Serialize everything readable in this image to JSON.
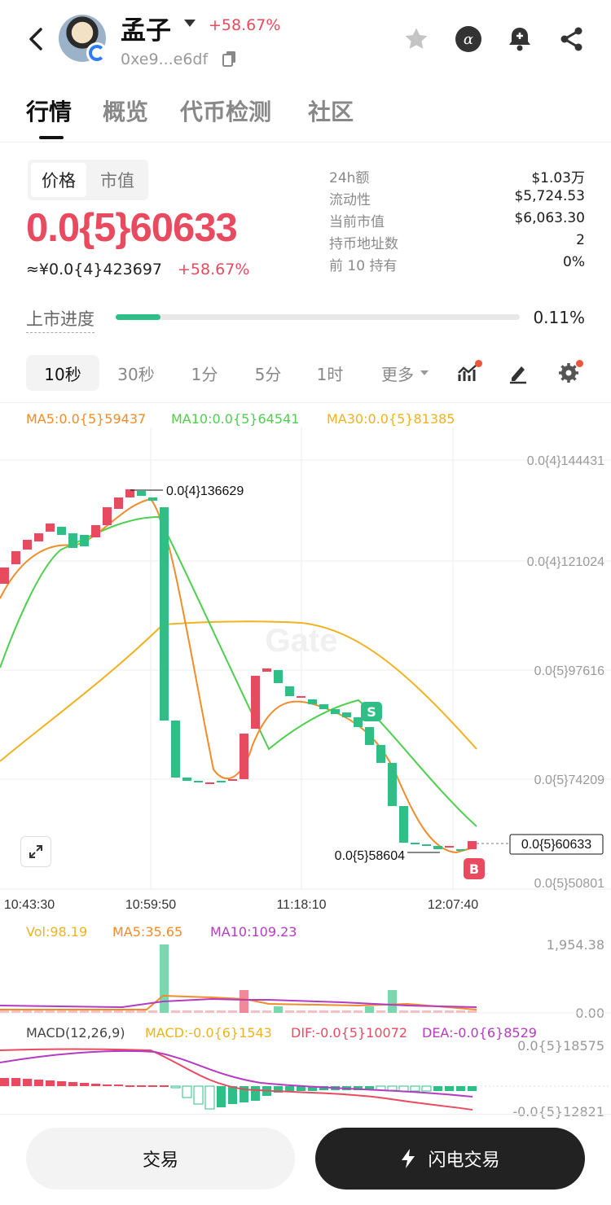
{
  "header": {
    "token_name": "孟子",
    "change": "+58.67%",
    "address": "0xe9...e6df",
    "icons": [
      "star-icon",
      "alpha-icon",
      "bell-plus-icon",
      "share-icon"
    ]
  },
  "tabs": [
    "行情",
    "概览",
    "代币检测",
    "社区"
  ],
  "price_toggle": [
    "价格",
    "市值"
  ],
  "price": {
    "main": "0.0{5}60633",
    "cny": "≈¥0.0{4}423697",
    "change": "+58.67%"
  },
  "stats": [
    {
      "label": "24h额",
      "value": "$1.03万"
    },
    {
      "label": "流动性",
      "value": "$5,724.53"
    },
    {
      "label": "当前市值",
      "value": "$6,063.30"
    },
    {
      "label": "持币地址数",
      "value": "2"
    },
    {
      "label": "前 10 持有",
      "value": "0%"
    }
  ],
  "listing": {
    "label": "上市进度",
    "value": "0.11%",
    "progress": 0.0011
  },
  "intervals": [
    "10秒",
    "30秒",
    "1分",
    "5分",
    "1时",
    "更多"
  ],
  "ma_legend": {
    "ma5": "MA5:0.0{5}59437",
    "ma10": "MA10:0.0{5}64541",
    "ma30": "MA30:0.0{5}81385"
  },
  "chart": {
    "y_ticks": [
      "0.0{4}144431",
      "0.0{4}121024",
      "0.0{5}97616",
      "0.0{5}74209",
      "0.0{5}50801"
    ],
    "x_ticks": [
      "10:43:30",
      "10:59:50",
      "11:18:10",
      "12:07:40"
    ],
    "high_label": "0.0{4}136629",
    "low_label": "0.0{5}58604",
    "last_label": "0.0{5}60633",
    "sell_marker": "S",
    "buy_marker": "B",
    "watermark": "Gate"
  },
  "volume": {
    "vol": "Vol:98.19",
    "ma5": "MA5:35.65",
    "ma10": "MA10:109.23",
    "y_max": "1,954.38",
    "y_min": "0.00"
  },
  "macd": {
    "params": "MACD(12,26,9)",
    "macd": "MACD:-0.0{6}1543",
    "dif": "DIF:-0.0{5}10072",
    "dea": "DEA:-0.0{6}8529",
    "y_top": "0.0{5}18575",
    "y_bottom": "-0.0{5}12821"
  },
  "buttons": {
    "trade": "交易",
    "flash": "闪电交易"
  },
  "colors": {
    "up": "#e84a5f",
    "down": "#2fbf86",
    "ma5": "#f08c2a",
    "ma10": "#4fcf4f",
    "ma30": "#f0b21e"
  }
}
